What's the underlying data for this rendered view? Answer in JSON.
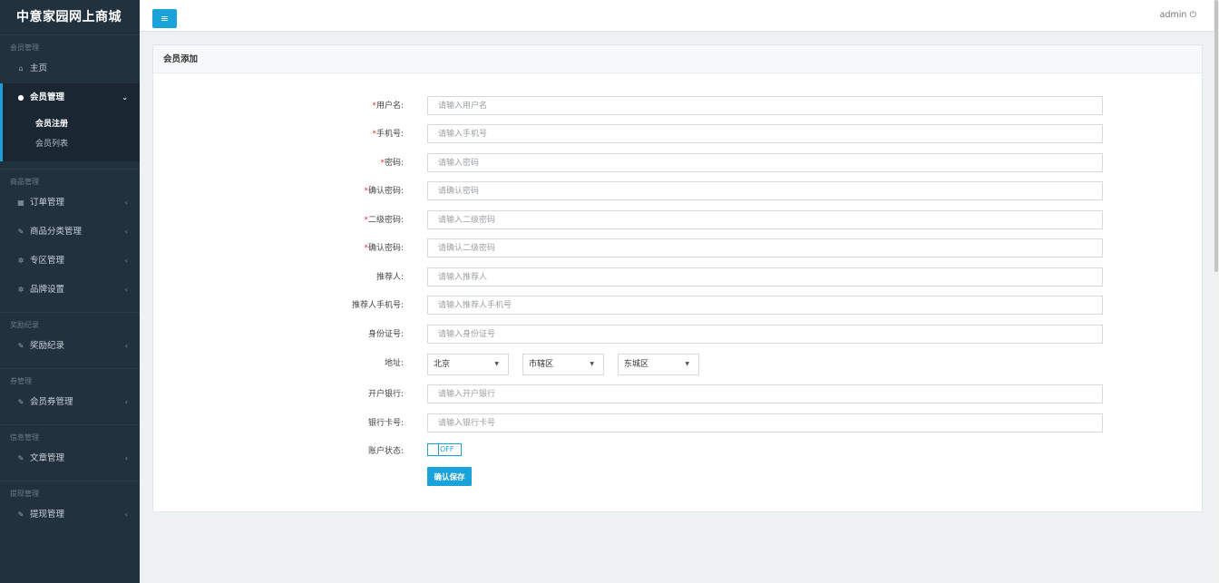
{
  "brand": "中意家园网上商城",
  "sidebar": {
    "sections": [
      {
        "title": "会员管理",
        "items": [
          {
            "label": "主页",
            "icon": "home-icon"
          },
          {
            "label": "会员管理",
            "icon": "users-icon",
            "active": true,
            "subitems": [
              "会员注册",
              "会员列表"
            ]
          }
        ]
      },
      {
        "title": "商品管理",
        "items": [
          {
            "label": "订单管理",
            "icon": "calendar-icon"
          },
          {
            "label": "商品分类管理",
            "icon": "edit-icon"
          },
          {
            "label": "专区管理",
            "icon": "cogs-icon"
          },
          {
            "label": "品牌设置",
            "icon": "cogs-icon"
          }
        ]
      },
      {
        "title": "奖励纪录",
        "items": [
          {
            "label": "奖励纪录",
            "icon": "edit-icon"
          }
        ]
      },
      {
        "title": "券管理",
        "items": [
          {
            "label": "会员券管理",
            "icon": "edit-icon"
          }
        ]
      },
      {
        "title": "信息管理",
        "items": [
          {
            "label": "文章管理",
            "icon": "edit-icon"
          }
        ]
      },
      {
        "title": "提现管理",
        "items": [
          {
            "label": "提现管理",
            "icon": "edit-icon"
          }
        ]
      }
    ]
  },
  "header": {
    "user": "admin",
    "power_icon": "⏻"
  },
  "panel": {
    "title": "会员添加"
  },
  "form": {
    "fields": [
      {
        "label": "用户名:",
        "required": true,
        "placeholder": "请输入用户名"
      },
      {
        "label": "手机号:",
        "required": true,
        "placeholder": "请输入手机号"
      },
      {
        "label": "密码:",
        "required": true,
        "placeholder": "请输入密码"
      },
      {
        "label": "确认密码:",
        "required": true,
        "placeholder": "请确认密码"
      },
      {
        "label": "二级密码:",
        "required": true,
        "placeholder": "请输入二级密码"
      },
      {
        "label": "确认密码:",
        "required": true,
        "placeholder": "请确认二级密码"
      },
      {
        "label": "推荐人:",
        "required": false,
        "placeholder": "请输入推荐人"
      },
      {
        "label": "推荐人手机号:",
        "required": false,
        "placeholder": "请输入推荐人手机号"
      },
      {
        "label": "身份证号:",
        "required": false,
        "placeholder": "请输入身份证号"
      }
    ],
    "address": {
      "label": "地址:",
      "province": "北京",
      "city": "市辖区",
      "district": "东城区"
    },
    "bank_fields": [
      {
        "label": "开户银行:",
        "placeholder": "请输入开户银行"
      },
      {
        "label": "银行卡号:",
        "placeholder": "请输入银行卡号"
      }
    ],
    "status": {
      "label": "账户状态:",
      "toggle_text": "OFF"
    },
    "save_label": "确认保存"
  },
  "colors": {
    "accent": "#1aa3d9",
    "sidebar_bg": "#22313e",
    "required": "#e33333"
  }
}
